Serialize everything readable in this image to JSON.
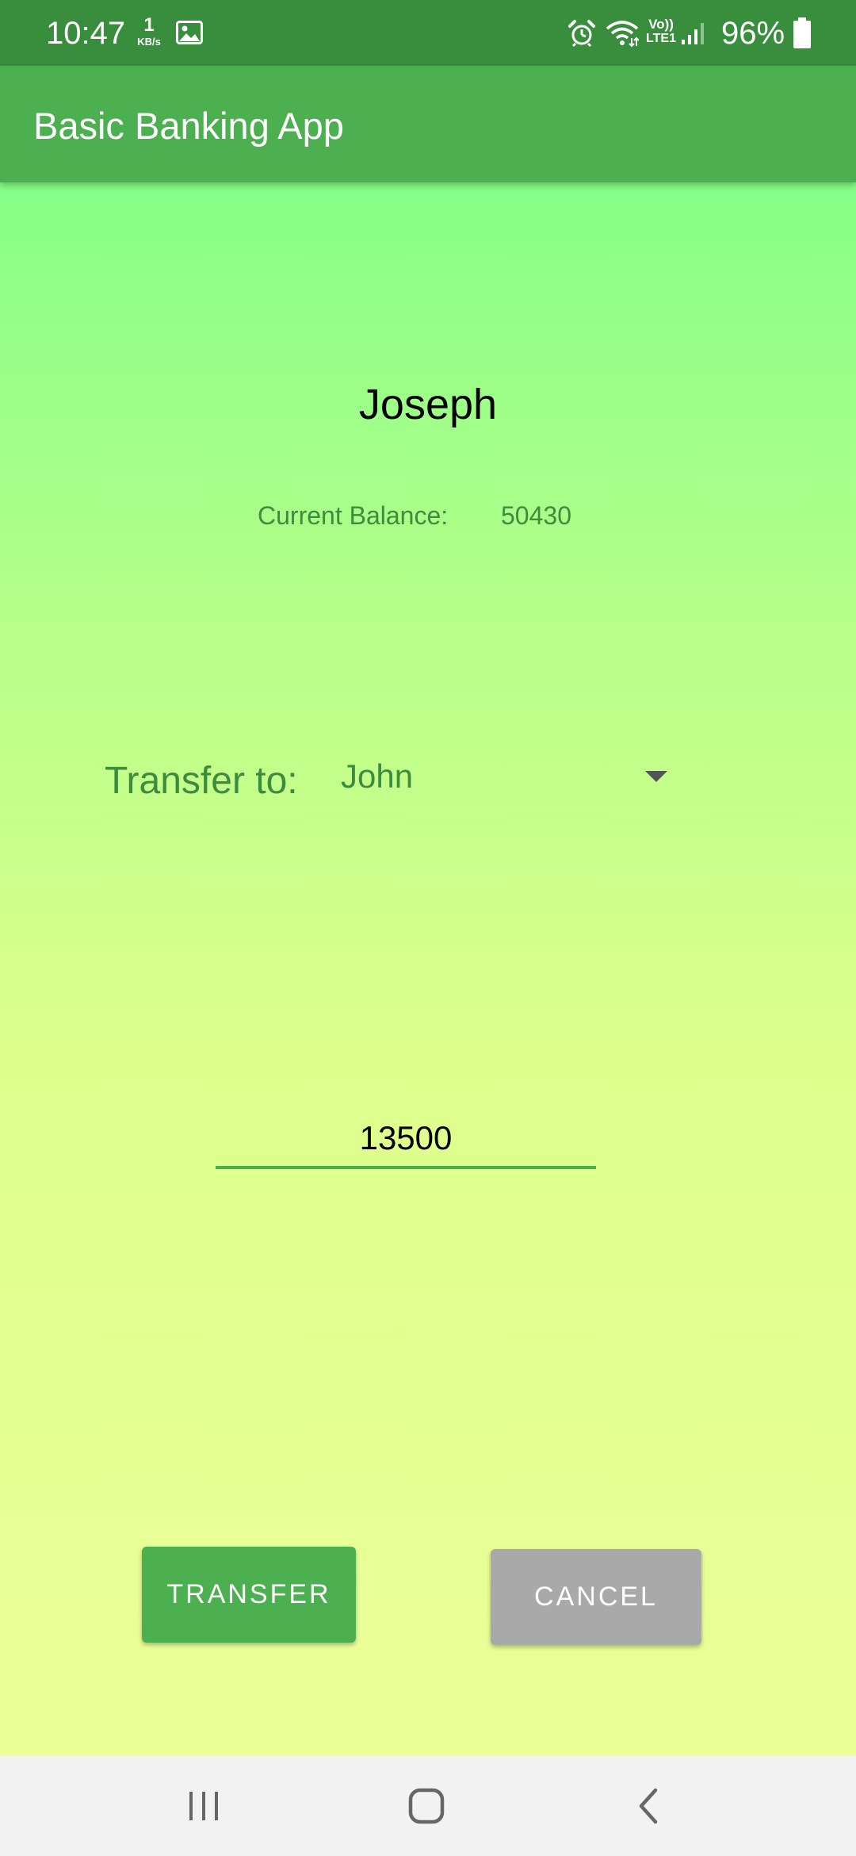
{
  "status_bar": {
    "time": "10:47",
    "net_speed_value": "1",
    "net_speed_unit": "KB/s",
    "volte_label_top": "Vo))",
    "volte_label_bottom": "LTE1",
    "battery_percent": "96%",
    "icons": [
      "gallery-icon",
      "alarm-icon",
      "wifi-icon",
      "volte-icon",
      "signal-icon",
      "battery-icon"
    ]
  },
  "app_bar": {
    "title": "Basic Banking App"
  },
  "account": {
    "name": "Joseph",
    "balance_label": "Current Balance:",
    "balance_value": "50430"
  },
  "transfer": {
    "label": "Transfer to:",
    "selected_recipient": "John",
    "amount": "13500"
  },
  "buttons": {
    "transfer_label": "TRANSFER",
    "cancel_label": "CANCEL"
  },
  "nav_bar": {
    "icons": [
      "recent-apps-icon",
      "home-icon",
      "back-icon"
    ]
  },
  "colors": {
    "status_bar": "#388e3c",
    "app_bar": "#4caf50",
    "accent_green": "#4caf50",
    "label_green": "#3d8b3d",
    "cancel_gray": "#a9a9a9",
    "gradient_top": "#86ff86",
    "gradient_bottom": "#ecff98"
  }
}
